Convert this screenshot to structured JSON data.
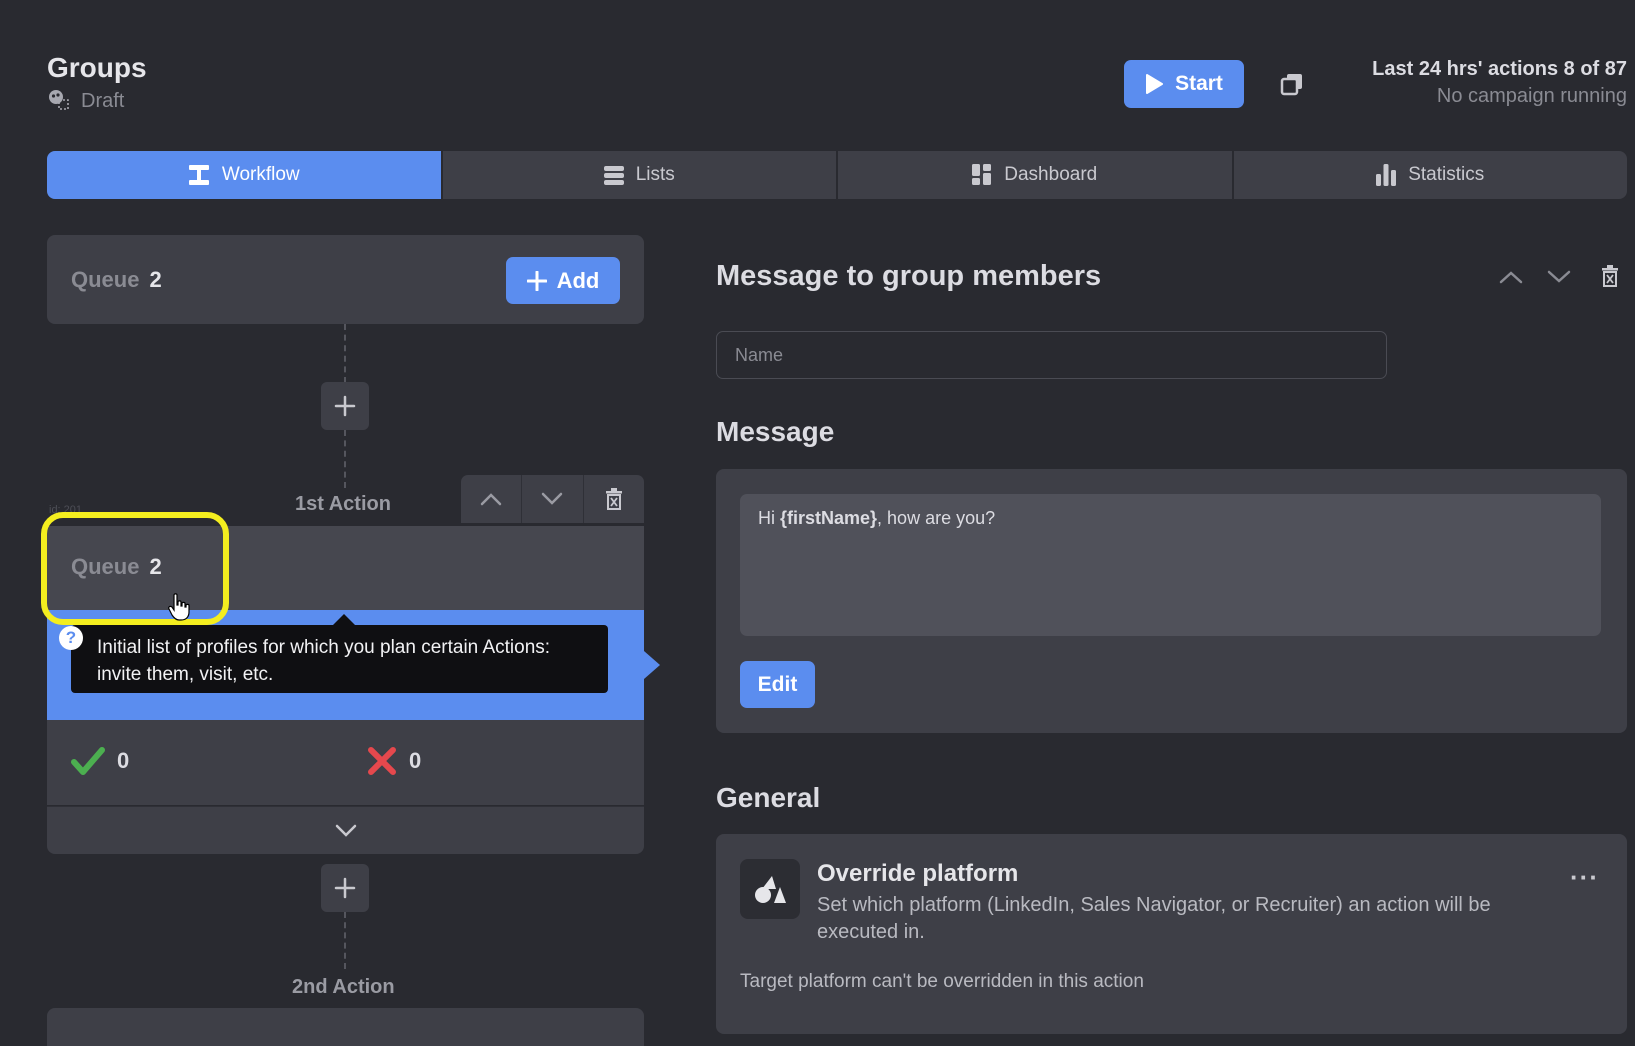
{
  "header": {
    "title": "Groups",
    "status": "Draft",
    "start_label": "Start",
    "actions_summary": "Last 24 hrs' actions 8 of 87",
    "campaign_status": "No campaign running"
  },
  "tabs": [
    {
      "label": "Workflow",
      "icon": "workflow-icon",
      "active": true
    },
    {
      "label": "Lists",
      "icon": "list-icon",
      "active": false
    },
    {
      "label": "Dashboard",
      "icon": "dashboard-icon",
      "active": false
    },
    {
      "label": "Statistics",
      "icon": "bar-chart-icon",
      "active": false
    }
  ],
  "workflow": {
    "queue_label": "Queue",
    "queue_count": "2",
    "add_label": "Add",
    "first_action": {
      "label": "1st Action",
      "id_tag": "id: 201",
      "queue_label": "Queue",
      "queue_count": "2",
      "tooltip": "Initial list of profiles for which you plan certain Actions: invite them, visit, etc.",
      "success_count": "0",
      "failure_count": "0"
    },
    "second_action": {
      "label": "2nd Action"
    }
  },
  "detail": {
    "title": "Message to group members",
    "name_placeholder": "Name",
    "message_title": "Message",
    "message_prefix": "Hi ",
    "message_variable": "{firstName}",
    "message_suffix": ", how are you?",
    "edit_label": "Edit",
    "general_title": "General",
    "override": {
      "title": "Override platform",
      "description": "Set which platform (LinkedIn, Sales Navigator, or Recruiter) an action will be executed in.",
      "note": "Target platform can't be overridden in this action"
    }
  },
  "colors": {
    "accent": "#5b8def",
    "background": "#292a30",
    "card": "#3e3f47",
    "success": "#4caf50",
    "failure": "#e5484d",
    "highlight": "#f4ee1f"
  }
}
